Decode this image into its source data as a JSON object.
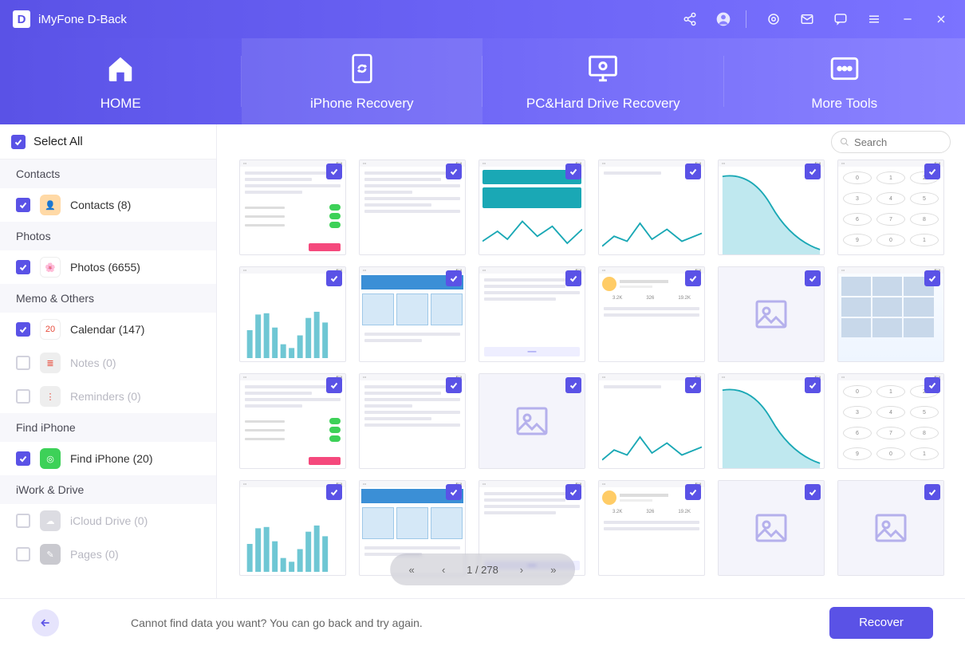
{
  "app": {
    "logo_letter": "D",
    "title": "iMyFone D-Back"
  },
  "nav": {
    "tabs": [
      {
        "label": "HOME"
      },
      {
        "label": "iPhone Recovery"
      },
      {
        "label": "PC&Hard Drive Recovery"
      },
      {
        "label": "More Tools"
      }
    ],
    "active_index": 1
  },
  "sidebar": {
    "select_all": "Select All",
    "groups": [
      {
        "title": "Contacts",
        "items": [
          {
            "label": "Contacts (8)",
            "checked": true,
            "icon_bg": "#ffd9a6",
            "icon_glyph": "👤"
          }
        ]
      },
      {
        "title": "Photos",
        "items": [
          {
            "label": "Photos (6655)",
            "checked": true,
            "icon_bg": "#ffffff",
            "icon_glyph": "🌸"
          }
        ]
      },
      {
        "title": "Memo & Others",
        "items": [
          {
            "label": "Calendar (147)",
            "checked": true,
            "icon_bg": "#ffffff",
            "icon_glyph": "20"
          },
          {
            "label": "Notes (0)",
            "checked": false,
            "icon_bg": "#eeeeee",
            "icon_glyph": "≣"
          },
          {
            "label": "Reminders (0)",
            "checked": false,
            "icon_bg": "#eeeeee",
            "icon_glyph": "⋮"
          }
        ]
      },
      {
        "title": "Find iPhone",
        "items": [
          {
            "label": "Find iPhone (20)",
            "checked": true,
            "icon_bg": "#3dd158",
            "icon_glyph": "◎"
          }
        ]
      },
      {
        "title": "iWork & Drive",
        "items": [
          {
            "label": "iCloud Drive (0)",
            "checked": false,
            "icon_bg": "#dcdce2",
            "icon_glyph": "☁"
          },
          {
            "label": "Pages (0)",
            "checked": false,
            "icon_bg": "#c9c9cf",
            "icon_glyph": "✎"
          }
        ]
      }
    ]
  },
  "search": {
    "placeholder": "Search"
  },
  "pager": {
    "current": 1,
    "total": 278,
    "display": "1 / 278"
  },
  "footer": {
    "message": "Cannot find data you want? You can go back and try again.",
    "recover": "Recover"
  },
  "thumbnails": {
    "count": 24,
    "all_checked": true
  }
}
